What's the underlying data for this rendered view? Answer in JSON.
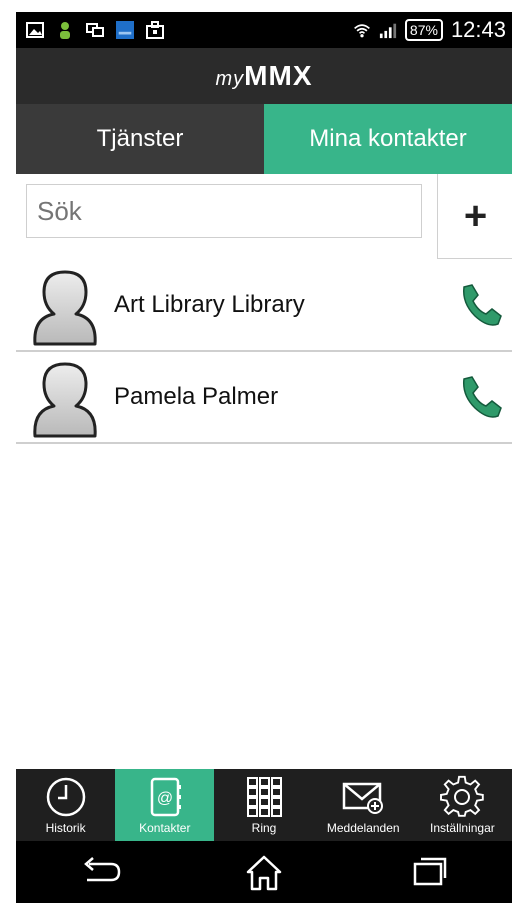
{
  "status_bar": {
    "battery": "87%",
    "time": "12:43"
  },
  "app": {
    "logo_prefix": "my",
    "logo_main": "MMX"
  },
  "tabs": [
    {
      "label": "Tjänster"
    },
    {
      "label": "Mina kontakter"
    }
  ],
  "search": {
    "placeholder": "Sök"
  },
  "add_button": {
    "label": "+"
  },
  "contacts": [
    {
      "name": "Art Library Library"
    },
    {
      "name": "Pamela Palmer"
    }
  ],
  "bottom_nav": [
    {
      "label": "Historik",
      "icon": "clock-icon"
    },
    {
      "label": "Kontakter",
      "icon": "address-book-icon"
    },
    {
      "label": "Ring",
      "icon": "keypad-icon"
    },
    {
      "label": "Meddelanden",
      "icon": "envelope-icon"
    },
    {
      "label": "Inställningar",
      "icon": "gear-icon"
    }
  ],
  "colors": {
    "accent": "#38b58a",
    "call_green": "#2f9a6a"
  }
}
